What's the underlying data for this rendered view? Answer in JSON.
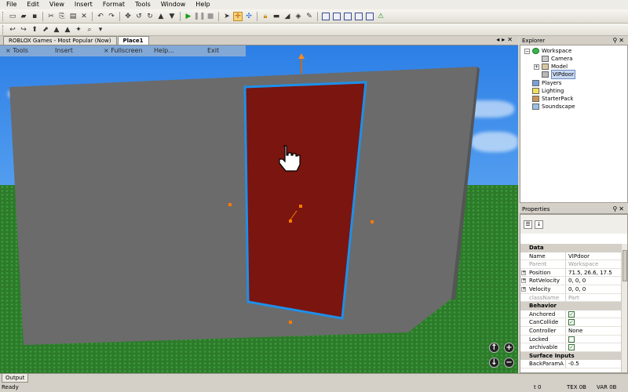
{
  "menu": [
    "File",
    "Edit",
    "View",
    "Insert",
    "Format",
    "Tools",
    "Window",
    "Help"
  ],
  "doc_tabs": [
    {
      "label": "ROBLOX Games - Most Popular (Now)"
    },
    {
      "label": "Place1"
    }
  ],
  "ingame_menu": {
    "tools": "× Tools",
    "insert": "Insert",
    "fullscreen": "× Fullscreen",
    "help": "Help...",
    "exit": "Exit"
  },
  "explorer": {
    "title": "Explorer",
    "items": [
      {
        "label": "Workspace",
        "icon": "globe-icon"
      },
      {
        "label": "Camera",
        "icon": "camera-icon"
      },
      {
        "label": "Model",
        "icon": "model-icon"
      },
      {
        "label": "VIPdoor",
        "icon": "part-icon"
      },
      {
        "label": "Players",
        "icon": "players-icon"
      },
      {
        "label": "Lighting",
        "icon": "lighting-icon"
      },
      {
        "label": "StarterPack",
        "icon": "starterpack-icon"
      },
      {
        "label": "Soundscape",
        "icon": "soundscape-icon"
      }
    ]
  },
  "properties": {
    "title": "Properties",
    "sections": [
      {
        "category": "Data",
        "rows": [
          {
            "name": "Name",
            "value": "VIPdoor"
          },
          {
            "name": "Parent",
            "value": "Workspace",
            "dim": true
          },
          {
            "name": "Position",
            "value": "71.5, 26.6, 17.5",
            "expand": true
          },
          {
            "name": "RotVelocity",
            "value": "0, 0, 0",
            "expand": true
          },
          {
            "name": "Velocity",
            "value": "0, 0, 0",
            "expand": true
          },
          {
            "name": "className",
            "value": "Part",
            "dim": true
          }
        ]
      },
      {
        "category": "Behavior",
        "rows": [
          {
            "name": "Anchored",
            "check": true
          },
          {
            "name": "CanCollide",
            "check": true
          },
          {
            "name": "Controller",
            "value": "None"
          },
          {
            "name": "Locked",
            "check": false
          },
          {
            "name": "archivable",
            "check": true
          }
        ]
      },
      {
        "category": "Surface Inputs",
        "rows": [
          {
            "name": "BackParamA",
            "value": "-0.5"
          }
        ]
      }
    ]
  },
  "output_tab": "Output",
  "status": {
    "left": "Ready",
    "t": "t 0",
    "tex": "TEX 0B",
    "var": "VAR 0B"
  },
  "colors": {
    "sky": "#3b8be9",
    "ground": "#2d7a2b",
    "wall": "#6e6e6e",
    "door": "#7a1510",
    "selection": "#1f8fe8",
    "handle": "#ff7a00"
  }
}
